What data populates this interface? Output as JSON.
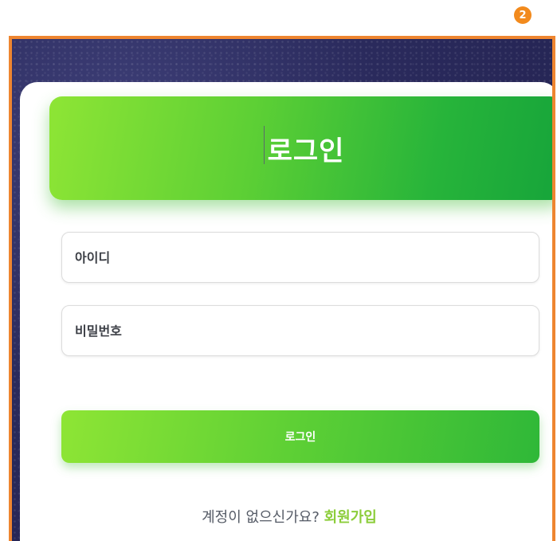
{
  "badge": {
    "number": "2"
  },
  "header": {
    "title": "로그인"
  },
  "form": {
    "username_placeholder": "아이디",
    "password_placeholder": "비밀번호",
    "submit_label": "로그인"
  },
  "footer": {
    "prompt": "계정이 없으신가요?",
    "signup_link": "회원가입"
  },
  "colors": {
    "accent": "#27b43a",
    "accent_light": "#8ee535",
    "link": "#8ccd3a",
    "frame_border": "#ee8530"
  }
}
